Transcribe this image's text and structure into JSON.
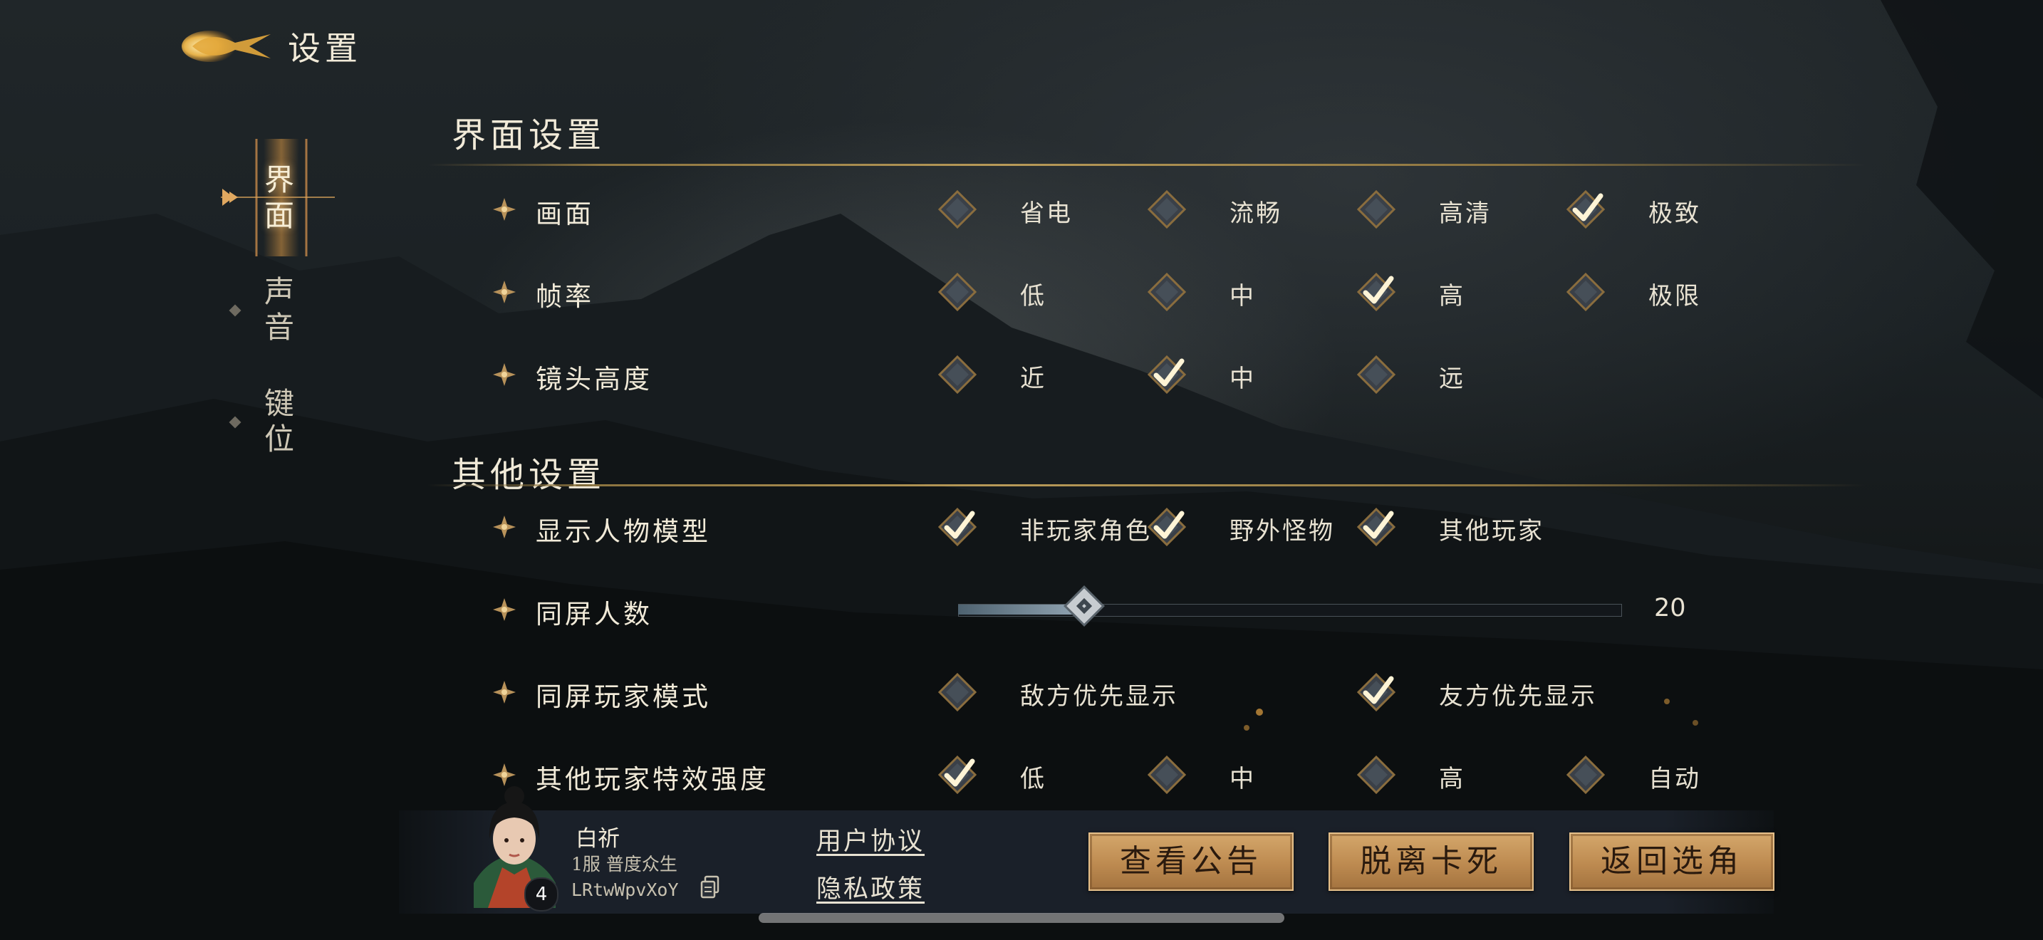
{
  "header": {
    "title": "设置",
    "icon": "golden-fish-emblem-icon"
  },
  "nav": {
    "items": [
      {
        "label": "界面",
        "active": true
      },
      {
        "label": "声音",
        "active": false
      },
      {
        "label": "键位",
        "active": false
      }
    ]
  },
  "sections": {
    "interface": {
      "title": "界面设置",
      "rows": {
        "graphics": {
          "label": "画面",
          "options": [
            {
              "label": "省电",
              "checked": false
            },
            {
              "label": "流畅",
              "checked": false
            },
            {
              "label": "高清",
              "checked": false
            },
            {
              "label": "极致",
              "checked": true
            }
          ]
        },
        "framerate": {
          "label": "帧率",
          "options": [
            {
              "label": "低",
              "checked": false
            },
            {
              "label": "中",
              "checked": false
            },
            {
              "label": "高",
              "checked": true
            },
            {
              "label": "极限",
              "checked": false
            }
          ]
        },
        "camera": {
          "label": "镜头高度",
          "options": [
            {
              "label": "近",
              "checked": false
            },
            {
              "label": "中",
              "checked": true
            },
            {
              "label": "远",
              "checked": false
            }
          ]
        }
      }
    },
    "other": {
      "title": "其他设置",
      "rows": {
        "models": {
          "label": "显示人物模型",
          "options": [
            {
              "label": "非玩家角色",
              "checked": true
            },
            {
              "label": "野外怪物",
              "checked": true
            },
            {
              "label": "其他玩家",
              "checked": true
            }
          ]
        },
        "onscreen_count": {
          "label": "同屏人数",
          "value": "20",
          "fraction": 0.19
        },
        "player_mode": {
          "label": "同屏玩家模式",
          "options": [
            {
              "label": "敌方优先显示",
              "checked": false
            },
            {
              "label": "友方优先显示",
              "checked": true
            }
          ]
        },
        "effects": {
          "label": "其他玩家特效强度",
          "options": [
            {
              "label": "低",
              "checked": true
            },
            {
              "label": "中",
              "checked": false
            },
            {
              "label": "高",
              "checked": false
            },
            {
              "label": "自动",
              "checked": false
            }
          ]
        }
      }
    }
  },
  "player": {
    "name": "白祈",
    "server": "1服 普度众生",
    "uid": "LRtwWpvXoY",
    "level": "4"
  },
  "links": {
    "user_agreement": "用户协议",
    "privacy_policy": "隐私政策"
  },
  "buttons": {
    "notice": "查看公告",
    "unstuck": "脱离卡死",
    "back": "返回选角"
  },
  "colors": {
    "gold": "#b89a58",
    "button": "#c99a5e",
    "check": "#fff4d6"
  }
}
